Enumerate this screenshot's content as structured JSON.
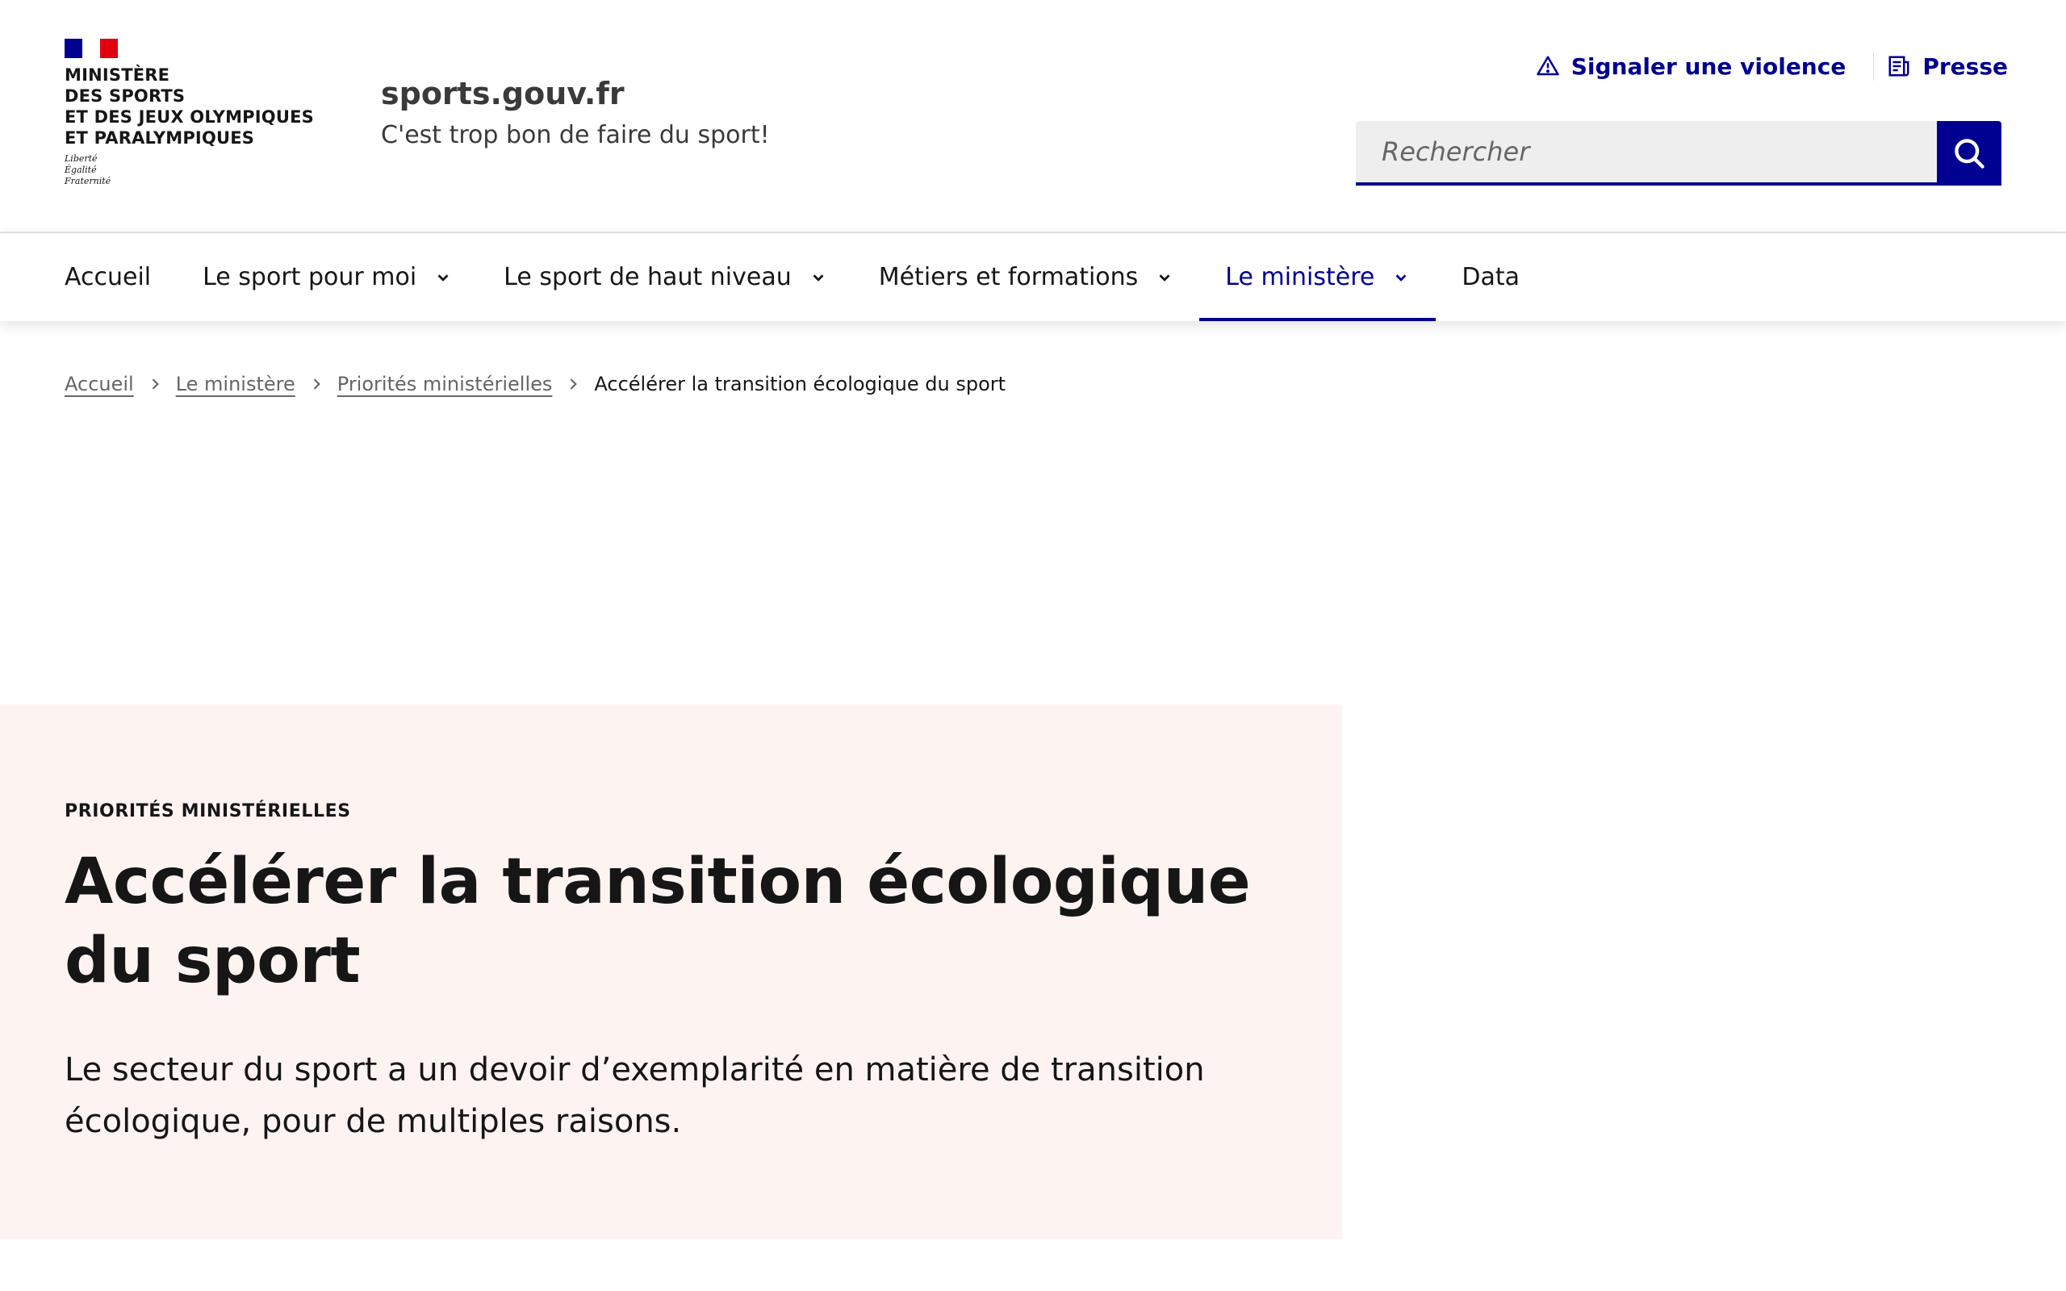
{
  "header": {
    "flag_colors": {
      "blue": "#000091",
      "white": "#ffffff",
      "red": "#e1000f"
    },
    "ministry_lines": [
      "Ministère",
      "des Sports",
      "et des Jeux Olympiques",
      "et Paralympiques"
    ],
    "motto_lines": [
      "Liberté",
      "Égalité",
      "Fraternité"
    ],
    "site_title": "sports.gouv.fr",
    "site_tagline": "C'est trop bon de faire du sport!",
    "tools": {
      "report": {
        "label": "Signaler une violence",
        "icon": "warning-icon"
      },
      "press": {
        "label": "Presse",
        "icon": "newspaper-icon"
      }
    },
    "search": {
      "placeholder": "Rechercher",
      "value": "",
      "icon": "search-icon"
    }
  },
  "nav": {
    "items": [
      {
        "label": "Accueil",
        "has_menu": false,
        "active": false
      },
      {
        "label": "Le sport pour moi",
        "has_menu": true,
        "active": false
      },
      {
        "label": "Le sport de haut niveau",
        "has_menu": true,
        "active": false
      },
      {
        "label": "Métiers et formations",
        "has_menu": true,
        "active": false
      },
      {
        "label": "Le ministère",
        "has_menu": true,
        "active": true
      },
      {
        "label": "Data",
        "has_menu": false,
        "active": false
      }
    ]
  },
  "breadcrumb": {
    "items": [
      {
        "label": "Accueil",
        "link": true
      },
      {
        "label": "Le ministère",
        "link": true
      },
      {
        "label": "Priorités ministérielles",
        "link": true
      },
      {
        "label": "Accélérer la transition écologique du sport",
        "link": false
      }
    ]
  },
  "hero": {
    "eyebrow": "Priorités ministérielles",
    "title": "Accélérer la transition écologique du sport",
    "lead": "Le secteur du sport a un devoir d’exemplarité en matière de transition écologique, pour de multiples raisons."
  },
  "colors": {
    "accent": "#000091",
    "hero_background": "#fdf4f2",
    "text": "#161616",
    "muted_text": "#666666"
  }
}
